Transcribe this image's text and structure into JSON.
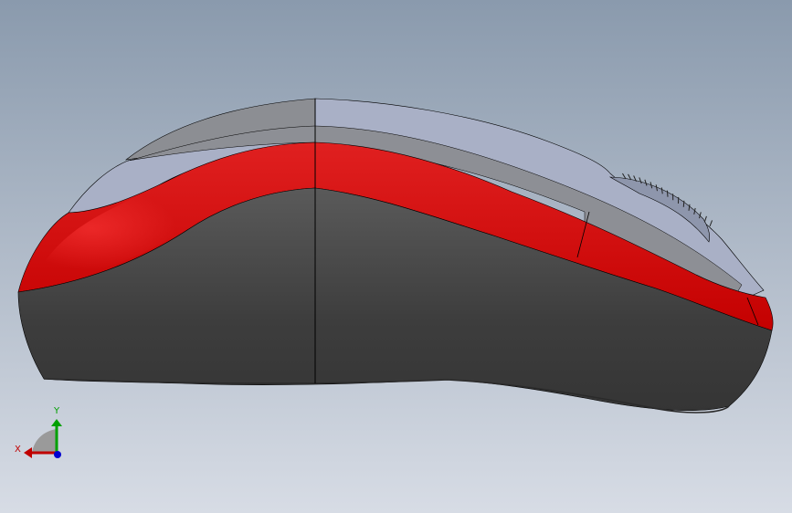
{
  "viewport": {
    "background_top": "#8a9aad",
    "background_bottom": "#d7dce5"
  },
  "model": {
    "palette": {
      "shell_top": "#a9b0c6",
      "shell_grey_band": "#8d8f95",
      "accent_red": "#c40000",
      "accent_red_highlight": "#e02020",
      "base_dark": "#3d3d3d",
      "base_dark_light": "#5a5a5a",
      "scroll_wheel": "#8e96ac",
      "edge_line": "#000000"
    }
  },
  "triad": {
    "x_label": "X",
    "y_label": "Y",
    "x_color": "#c00000",
    "y_color": "#00a000",
    "z_color": "#0000d0"
  }
}
